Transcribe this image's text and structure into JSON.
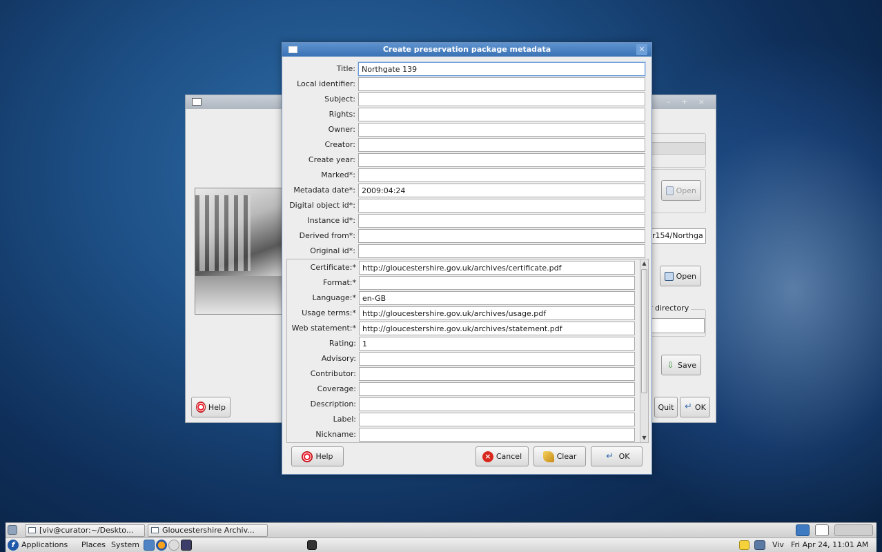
{
  "bg_window": {
    "help_label": "Help",
    "open1_label": "Open",
    "open2_label": "Open",
    "path_fragment": "r154/Northga",
    "frame_label_fragment": "r directory",
    "save_label": "Save",
    "quit_label": "Quit",
    "ok_label": "OK",
    "controls": "– + ×"
  },
  "dialog": {
    "title": "Create preservation package metadata",
    "close_glyph": "✕",
    "fields": [
      {
        "label": "Title:",
        "value": "Northgate 139"
      },
      {
        "label": "Local identifier:",
        "value": ""
      },
      {
        "label": "Subject:",
        "value": ""
      },
      {
        "label": "Rights:",
        "value": ""
      },
      {
        "label": "Owner:",
        "value": ""
      },
      {
        "label": "Creator:",
        "value": ""
      },
      {
        "label": "Create year:",
        "value": ""
      },
      {
        "label": "Marked*:",
        "value": ""
      },
      {
        "label": "Metadata date*:",
        "value": "2009:04:24"
      },
      {
        "label": "Digital object id*:",
        "value": ""
      },
      {
        "label": "Instance id*:",
        "value": ""
      },
      {
        "label": "Derived from*:",
        "value": ""
      },
      {
        "label": "Original id*:",
        "value": ""
      }
    ],
    "scroll_fields": [
      {
        "label": "Certificate:*",
        "value": "http://gloucestershire.gov.uk/archives/certificate.pdf"
      },
      {
        "label": "Format:*",
        "value": ""
      },
      {
        "label": "Language:*",
        "value": "en-GB"
      },
      {
        "label": "Usage terms:*",
        "value": "http://gloucestershire.gov.uk/archives/usage.pdf"
      },
      {
        "label": "Web statement:*",
        "value": "http://gloucestershire.gov.uk/archives/statement.pdf"
      },
      {
        "label": "Rating:",
        "value": "1"
      },
      {
        "label": "Advisory:",
        "value": ""
      },
      {
        "label": "Contributor:",
        "value": ""
      },
      {
        "label": "Coverage:",
        "value": ""
      },
      {
        "label": "Description:",
        "value": ""
      },
      {
        "label": "Label:",
        "value": ""
      },
      {
        "label": "Nickname:",
        "value": ""
      }
    ],
    "buttons": {
      "help": "Help",
      "cancel": "Cancel",
      "clear": "Clear",
      "ok": "OK"
    }
  },
  "taskbar": {
    "tasks": [
      {
        "label": "[viv@curator:~/Deskto..."
      },
      {
        "label": "Gloucestershire Archiv..."
      }
    ]
  },
  "panel": {
    "menus": [
      "Applications",
      "Places",
      "System"
    ],
    "user": "Viv",
    "clock": "Fri Apr 24, 11:01 AM"
  }
}
